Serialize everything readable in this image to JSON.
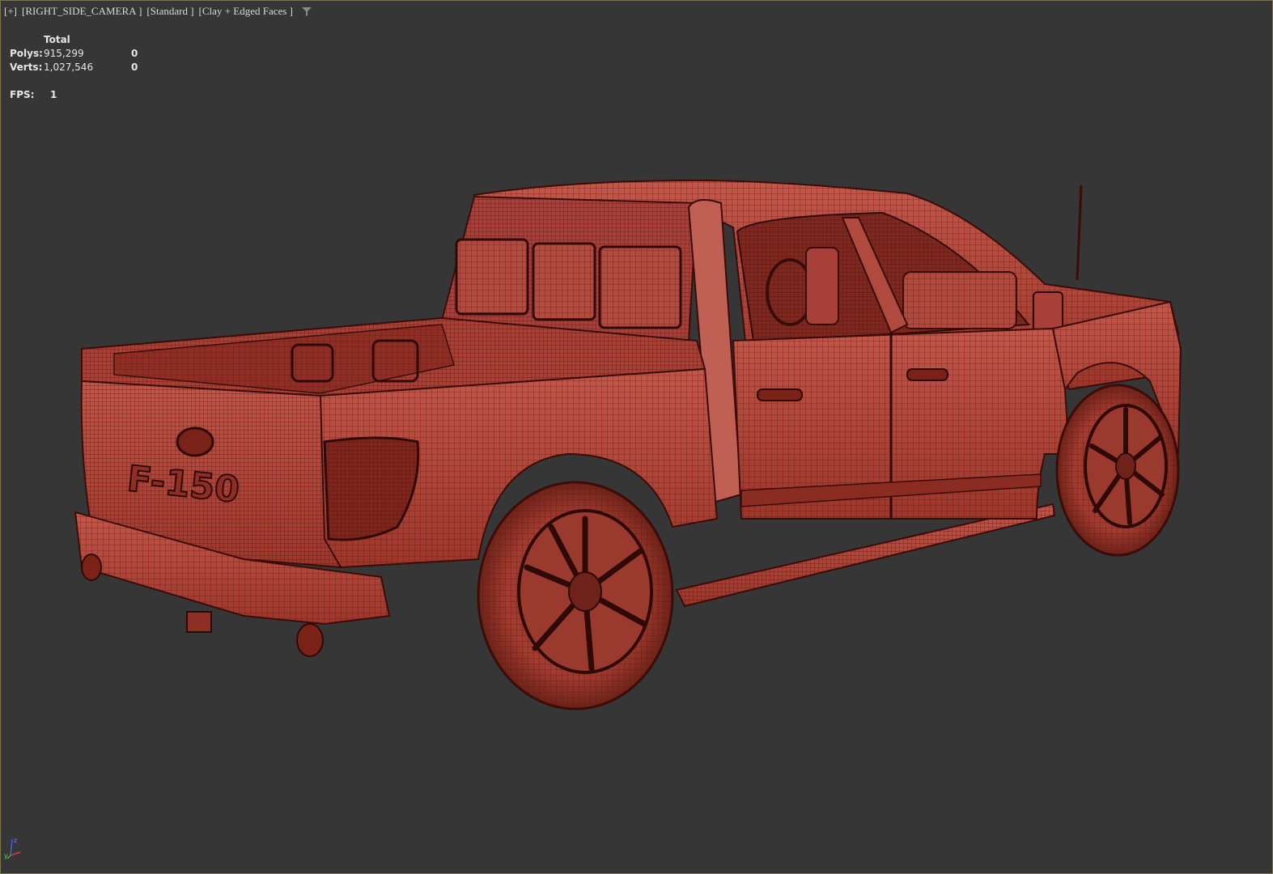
{
  "viewport": {
    "menu_label": "[+]",
    "camera_label": "[RIGHT_SIDE_CAMERA ]",
    "shading_preset": "[Standard ]",
    "display_mode": "[Clay + Edged Faces ]",
    "filter_icon": "funnel-icon"
  },
  "statistics": {
    "column_header": "Total",
    "polys_label": "Polys:",
    "polys_total": "915,299",
    "polys_selected": "0",
    "verts_label": "Verts:",
    "verts_total": "1,027,546",
    "verts_selected": "0",
    "fps_label": "FPS:",
    "fps_value": "1"
  },
  "gizmo": {
    "axes": [
      "x",
      "y",
      "z"
    ],
    "icon": "axis-tripod-icon"
  },
  "model": {
    "badge_text": "F-150",
    "clay_color": "#b84a3c",
    "edge_color": "#5a1510"
  }
}
